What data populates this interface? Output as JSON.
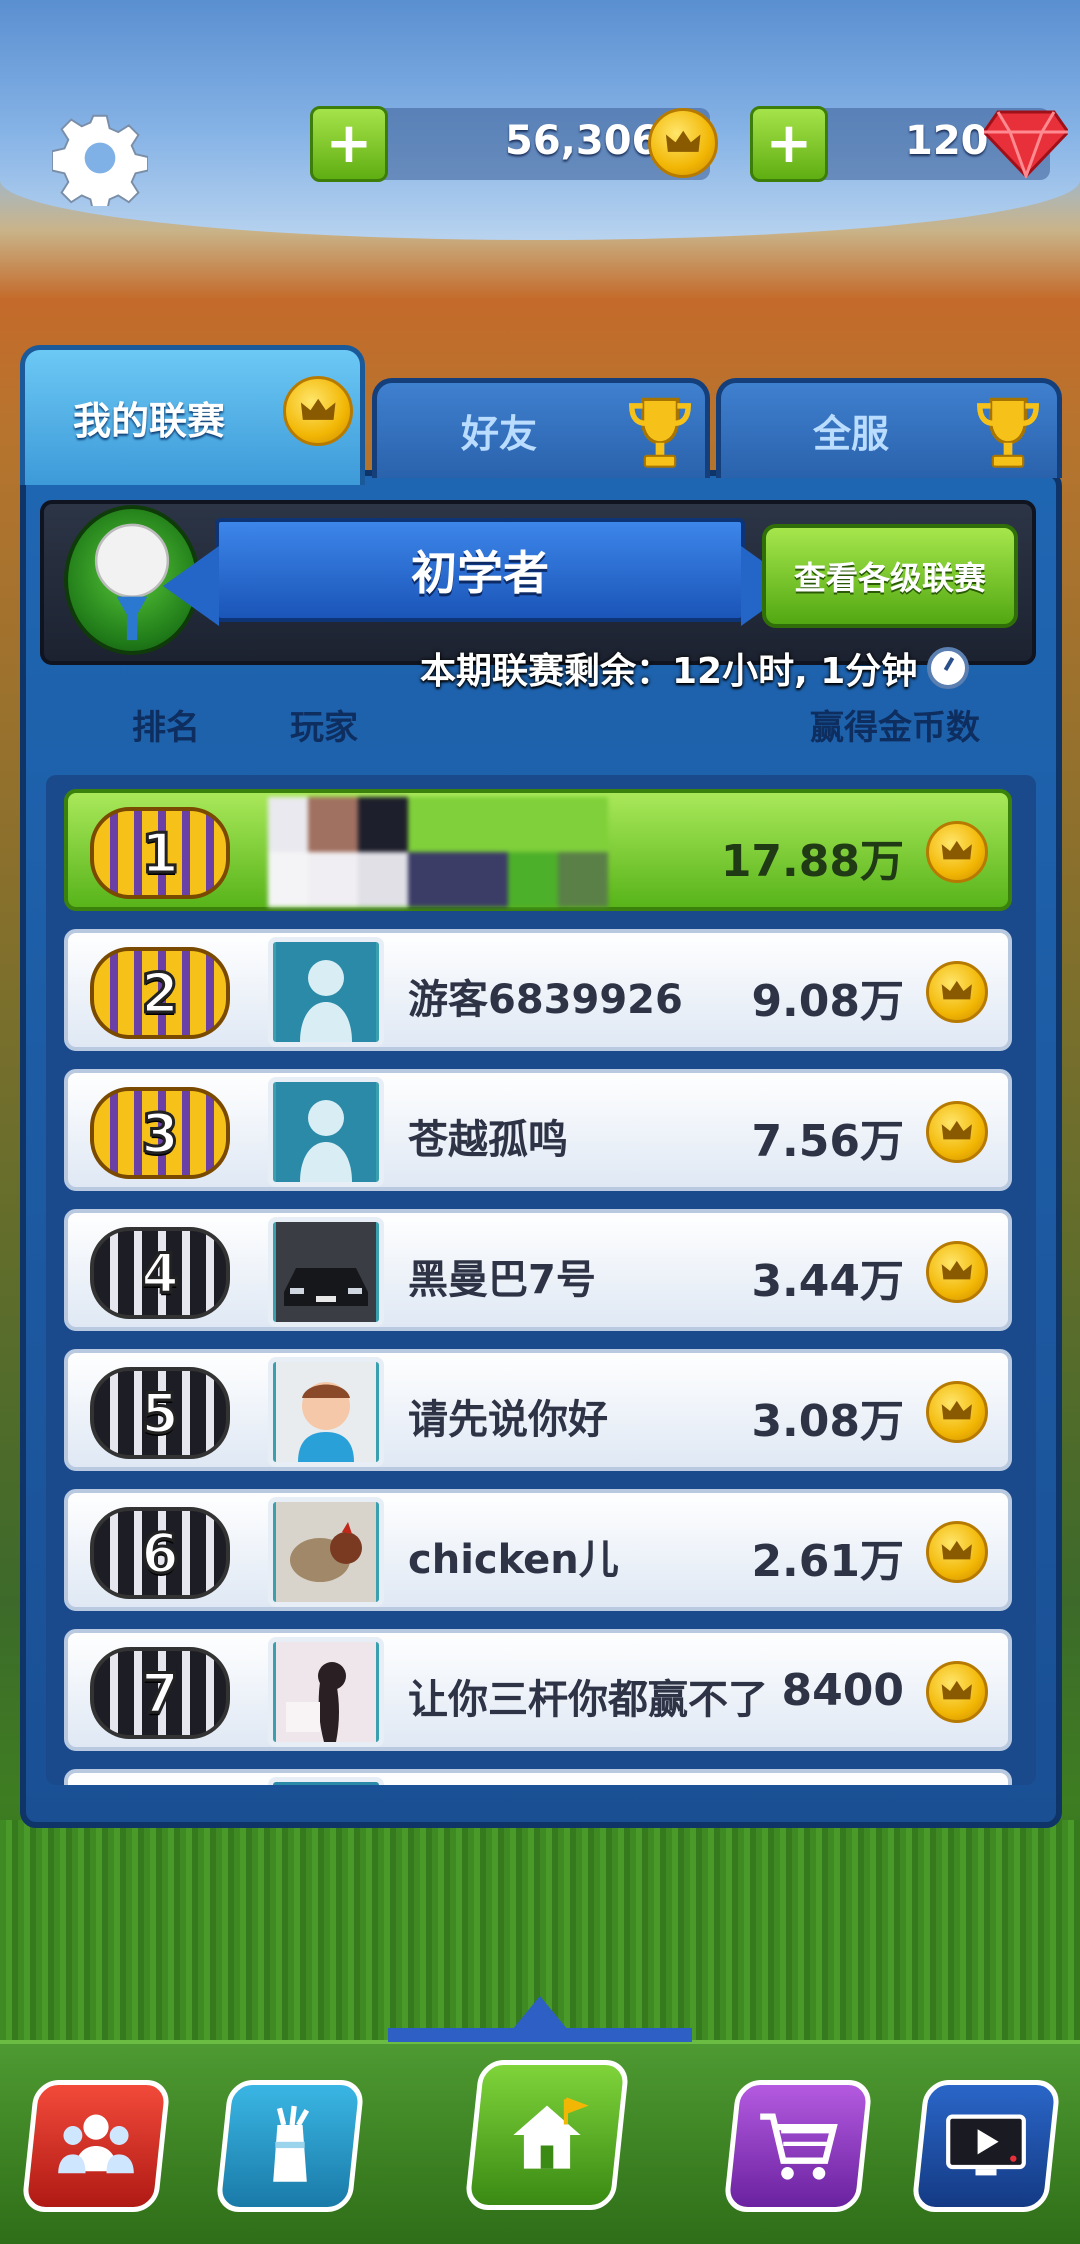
{
  "colors": {
    "panel_blue": "#1f66b2",
    "active_tab": "#4fb0e8",
    "highlight_green": "#58b41a",
    "coin_gold": "#f2b705",
    "gem_red": "#e8303a"
  },
  "topbar": {
    "settings_icon": "gear-icon",
    "coins": "56,306",
    "gems": "120"
  },
  "tabs": [
    {
      "label": "我的联赛",
      "icon": "crown-coin-icon",
      "active": true
    },
    {
      "label": "好友",
      "icon": "trophy-icon",
      "active": false
    },
    {
      "label": "全服",
      "icon": "trophy-icon",
      "active": false
    }
  ],
  "league": {
    "tier": "初学者",
    "view_all_button": "查看各级联赛",
    "time_remaining": "本期联赛剩余：12小时, 1分钟"
  },
  "columns": {
    "rank": "排名",
    "player": "玩家",
    "coins_won": "赢得金币数"
  },
  "leaderboard": [
    {
      "rank": "1",
      "name": "",
      "score": "17.88万",
      "medal": "gold",
      "avatar": "blurred-avatar",
      "is_me": true
    },
    {
      "rank": "2",
      "name": "游客6839926",
      "score": "9.08万",
      "medal": "gold",
      "avatar": "default-avatar"
    },
    {
      "rank": "3",
      "name": "苍越孤鸣",
      "score": "7.56万",
      "medal": "gold",
      "avatar": "default-avatar"
    },
    {
      "rank": "4",
      "name": "黑曼巴7号",
      "score": "3.44万",
      "medal": "silver",
      "avatar": "car-photo"
    },
    {
      "rank": "5",
      "name": "请先说你好",
      "score": "3.08万",
      "medal": "silver",
      "avatar": "child-photo"
    },
    {
      "rank": "6",
      "name": "chicken儿",
      "score": "2.61万",
      "medal": "silver",
      "avatar": "dog-photo"
    },
    {
      "rank": "7",
      "name": "让你三杆你都赢不了",
      "score": "8400",
      "medal": "silver",
      "avatar": "girl-photo"
    }
  ],
  "bottom_nav": [
    {
      "name": "social",
      "icon": "people-icon"
    },
    {
      "name": "clubs",
      "icon": "golf-bag-icon"
    },
    {
      "name": "home",
      "icon": "home-flag-icon",
      "active": true
    },
    {
      "name": "shop",
      "icon": "shopping-cart-icon"
    },
    {
      "name": "video",
      "icon": "tv-play-icon"
    }
  ]
}
